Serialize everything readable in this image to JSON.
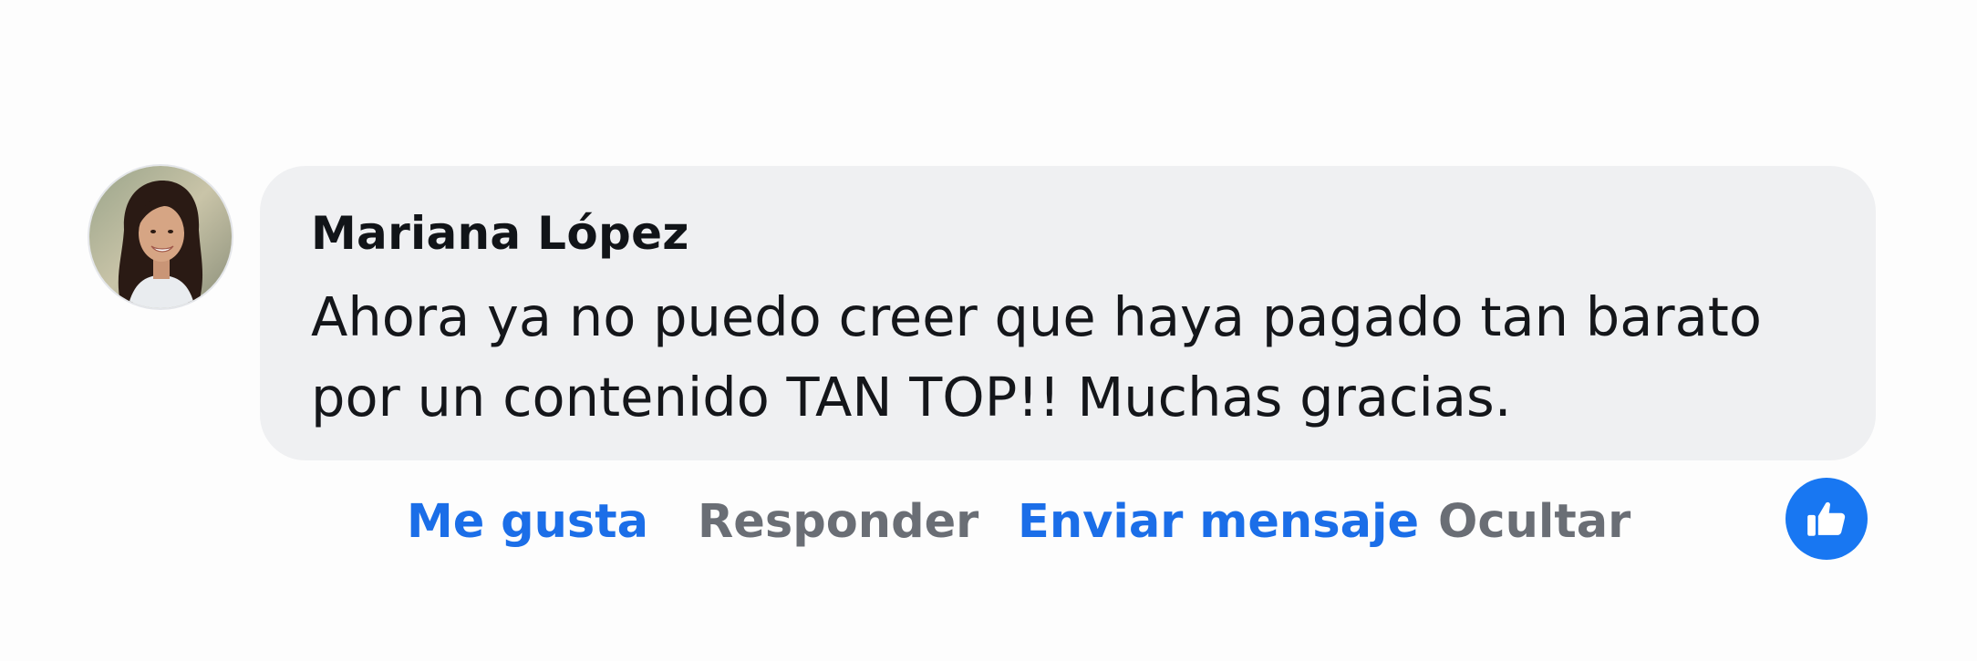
{
  "comment": {
    "author": "Mariana López",
    "text": "Ahora ya no puedo creer que haya pagado tan barato por un contenido TAN TOP!! Muchas gracias.",
    "avatar_icon": "profile-photo"
  },
  "actions": {
    "like": "Me gusta",
    "reply": "Responder",
    "send_message": "Enviar mensaje",
    "hide": "Ocultar"
  },
  "reaction": {
    "icon": "thumbs-up-icon",
    "color": "#1877f2"
  },
  "colors": {
    "bubble_bg": "#eff0f2",
    "link_blue": "#1b6ee8",
    "muted_gray": "#6a6e75"
  }
}
